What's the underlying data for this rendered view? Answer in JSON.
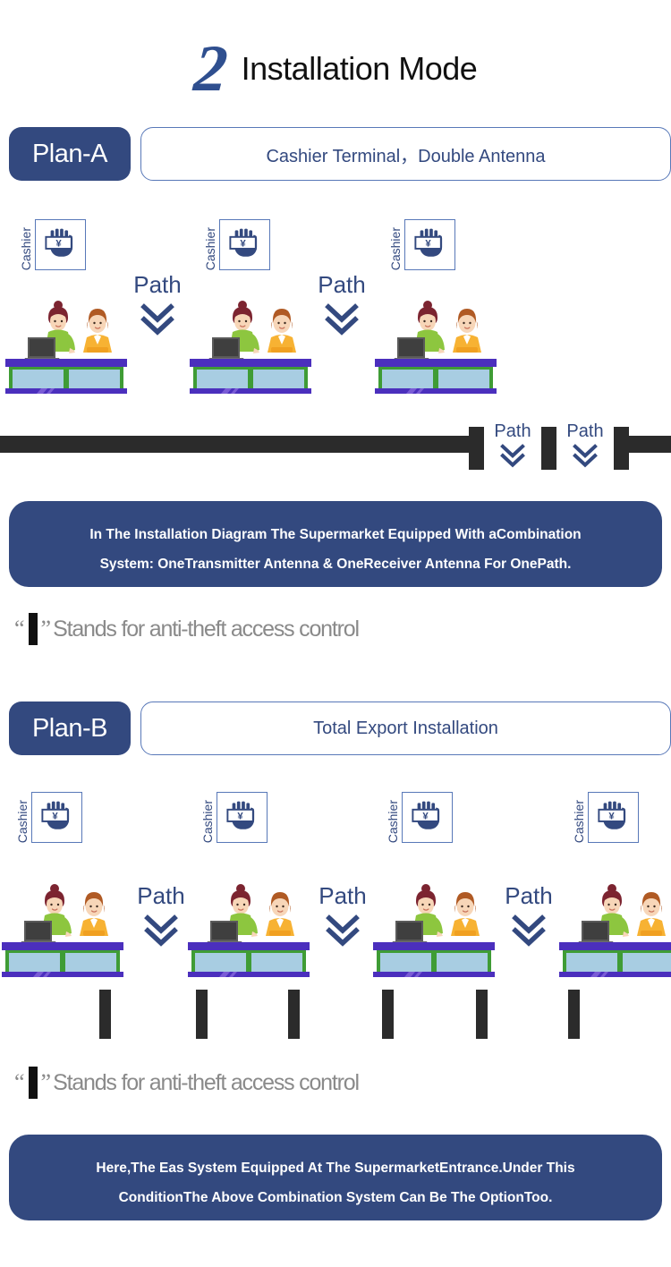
{
  "header": {
    "number": "2",
    "title": "Installation Mode"
  },
  "plan_a": {
    "badge": "Plan-A",
    "title": "Cashier Terminal，Double Antenna",
    "stations": [
      {
        "cashier_label": "Cashier",
        "icon": "cashier-terminal-icon"
      },
      {
        "cashier_label": "Cashier",
        "icon": "cashier-terminal-icon"
      },
      {
        "cashier_label": "Cashier",
        "icon": "cashier-terminal-icon"
      }
    ],
    "paths": [
      {
        "label": "Path"
      },
      {
        "label": "Path"
      }
    ],
    "wall_paths": [
      {
        "label": "Path"
      },
      {
        "label": "Path"
      }
    ],
    "info": "In The Installation Diagram The Supermarket Equipped With aCombination System: OneTransmitter Antenna & OneReceiver Antenna For OnePath.",
    "info_lines": [
      "In The Installation Diagram The Supermarket Equipped With aCombination",
      "System: OneTransmitter Antenna & OneReceiver Antenna For OnePath."
    ],
    "legend": {
      "quote_open": "“",
      "quote_close": "”",
      "text": "Stands for anti-theft access control"
    }
  },
  "plan_b": {
    "badge": "Plan-B",
    "title": "Total Export Installation",
    "stations": [
      {
        "cashier_label": "Cashier",
        "icon": "cashier-terminal-icon"
      },
      {
        "cashier_label": "Cashier",
        "icon": "cashier-terminal-icon"
      },
      {
        "cashier_label": "Cashier",
        "icon": "cashier-terminal-icon"
      },
      {
        "cashier_label": "Cashier",
        "icon": "cashier-terminal-icon"
      }
    ],
    "paths": [
      {
        "label": "Path"
      },
      {
        "label": "Path"
      },
      {
        "label": "Path"
      }
    ],
    "gate_bar_count": 6,
    "legend": {
      "quote_open": "“",
      "quote_close": "”",
      "text": "Stands for anti-theft access control"
    },
    "info_lines": [
      "Here,The Eas System Equipped At The SupermarketEntrance.Under This",
      "ConditionThe Above Combination System Can Be The OptionToo."
    ]
  },
  "colors": {
    "brand_blue": "#33497f",
    "accent_blue": "#2f4f8f",
    "border_blue": "#5878b8",
    "dark_bar": "#2b2b2b",
    "legend_grey": "#8a8a8a",
    "counter_green": "#3f9c35",
    "counter_purple": "#4b2fbd",
    "counter_glass": "#a8cde2",
    "shirt_green": "#8dc63f",
    "shirt_orange": "#f7b233",
    "hair_dark": "#7c2430",
    "hair_brown": "#b05a24",
    "skin": "#f7d6b8"
  }
}
